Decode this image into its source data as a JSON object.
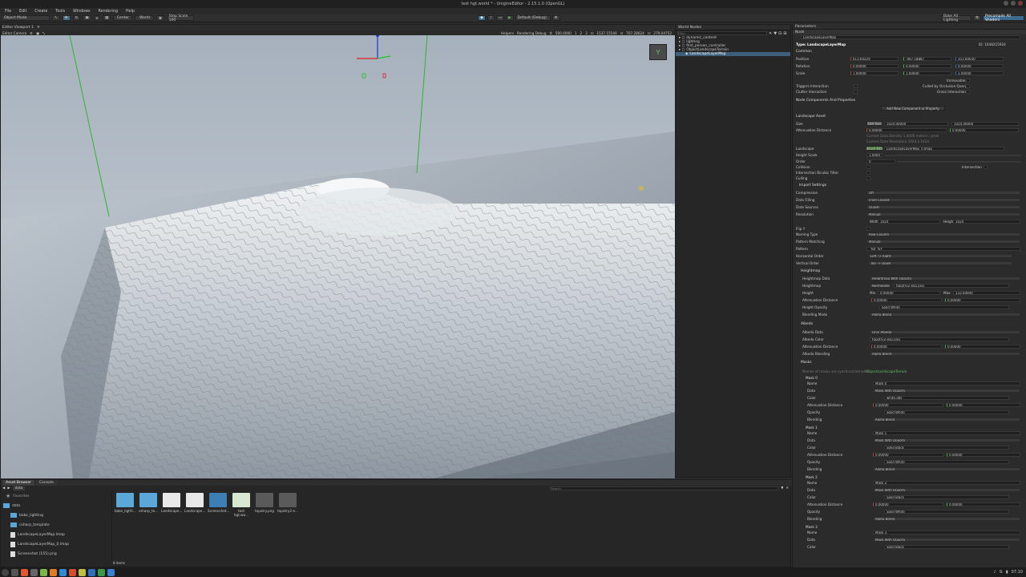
{
  "titlebar": {
    "title": "test hgt.world * - UnigineEditor - 2.15.1.0 (OpenGL)"
  },
  "menu": [
    "File",
    "Edit",
    "Create",
    "Tools",
    "Windows",
    "Rendering",
    "Help"
  ],
  "toolbar": {
    "mode": "Object Mode",
    "pivot": "Center",
    "space": "World",
    "step_label": "Step Scale 100",
    "play_label": "Default (Debug)",
    "bake_label": "Bake All Lighting",
    "precompile_label": "Precompile All Shaders"
  },
  "viewport": {
    "tab": "Editor Viewport 1",
    "camera": "Editor Camera",
    "helpers": "Helpers",
    "rendering_debug": "Rendering Debug",
    "speed": "500.0000",
    "coords": [
      "1",
      "2",
      "3"
    ],
    "x": "1537.15540",
    "y": "707.28624",
    "z": "279.04752"
  },
  "world_nodes": {
    "title": "World Nodes",
    "filter_placeholder": "Filter",
    "items": [
      {
        "label": "dynamic_content",
        "indent": 0,
        "sel": false
      },
      {
        "label": "lighting",
        "indent": 0,
        "sel": false
      },
      {
        "label": "first_person_controller",
        "indent": 0,
        "sel": false
      },
      {
        "label": "ObjectLandscapeTerrain",
        "indent": 0,
        "sel": false
      },
      {
        "label": "LandscapeLayerMap",
        "indent": 1,
        "sel": true
      }
    ]
  },
  "params": {
    "title": "Parameters",
    "tab": "Node",
    "node_name": "LandscapeLayerMap",
    "type": "Type: LandscapeLayerMap",
    "id": "ID: 1048215924",
    "common": "Common",
    "position": {
      "label": "Position",
      "x": "613.60229",
      "y": "-467.18887",
      "z": "353.00030"
    },
    "rotation": {
      "label": "Rotation",
      "x": "0.00000",
      "y": "0.00000",
      "z": "0.00000"
    },
    "scale": {
      "label": "Scale",
      "x": "1.00000",
      "y": "1.00000",
      "z": "1.00000"
    },
    "immovable": "Immovable",
    "triggers": "Triggers Interaction",
    "culled": "Culled by Occlusion Query",
    "clutter": "Clutter Interaction",
    "grass": "Grass Interaction",
    "components": "Node Components And Properties",
    "add_component": "Add New Component or Property",
    "landscape_asset": "Landscape Asset",
    "size_label": "Size",
    "size_btn": "Edit Size",
    "size_x": "1024.00000",
    "size_y": "1024.00000",
    "att_dist_label": "Attenuation Distance",
    "att_x": "0.00000",
    "att_y": "0.00000",
    "hint1": "Current Data Density 1.0000 meters / pixel",
    "hint2": "Current Data Resolution 1024 x 1024",
    "landscape_label": "Landscape",
    "brush_btn": "Brush Edit",
    "landscape_file": "LandscapeLayerMap_0.lmap",
    "height_scale_label": "Height Scale",
    "height_scale": "1.0000",
    "order_label": "Order",
    "order": "0",
    "collision_label": "Collision",
    "intersection_label": "Intersection",
    "bicubic_label": "Intersection Bicubic Filter",
    "culling_label": "Culling",
    "import_settings": "Import Settings",
    "compression_label": "Compression",
    "compression": "Off",
    "data_filling_label": "Data Filling",
    "data_filling": "From Closest",
    "data_sources_label": "Data Sources",
    "data_sources": "Quads",
    "resolution_label": "Resolution",
    "resolution": "Manual",
    "width_label": "Width",
    "width": "1024",
    "height_label": "Height",
    "height": "1024",
    "flip_label": "Flip Y",
    "naming_label": "Naming Type",
    "naming": "Row-Column",
    "pattern_matching_label": "Pattern Matching",
    "pattern_matching": "Manual",
    "pattern_label": "Pattern",
    "pattern": "_%X_%Y",
    "horiz_label": "Horizontal Order",
    "horiz": "Left -> Right",
    "vert_label": "Vertical Order",
    "vert": "Top -> Down",
    "heightmap": "Heightmap",
    "hm_data_label": "Heightmap Data",
    "hm_data": "Heightmap With Opacity",
    "hm_label": "Heightmap",
    "hm_mode": "Normalized",
    "hm_file": "topotry2-exp.png",
    "hm_height_label": "Height",
    "hm_min_label": "Min",
    "hm_min": "0.00000",
    "hm_max_label": "Max",
    "hm_max": "133.00000",
    "hm_att_label": "Attenuation Distance",
    "hm_att_x": "0.00000",
    "hm_att_y": "0.00000",
    "hm_opacity_label": "Height Opacity",
    "hm_opacity": "Solid White",
    "hm_blend_label": "Blending Mode",
    "hm_blend": "Alpha Blend",
    "albedo": "Albedo",
    "al_data_label": "Albedo Data",
    "al_data": "Only Albedo",
    "al_color_label": "Albedo Color",
    "al_file": "topotry2-exp.png",
    "al_att_label": "Attenuation Distance",
    "al_att_x": "0.00000",
    "al_att_y": "0.00000",
    "al_blend_label": "Albedo Blending",
    "al_blend": "Alpha Blend",
    "masks": "Masks",
    "masks_hint": "Names of masks are synchronized with",
    "masks_link": "ObjectLandscapeTerrain",
    "mask_items": [
      {
        "title": "Mask 0",
        "name": "Mask 0",
        "data": "Mask With Opacity",
        "color": "white.dds",
        "att_x": "0.00000",
        "att_y": "0.00000",
        "opacity": "Solid White",
        "blend": "Alpha Blend"
      },
      {
        "title": "Mask 1",
        "name": "Mask 1",
        "data": "Mask With Opacity",
        "color": "Solid Black",
        "att_x": "0.00000",
        "att_y": "0.00000",
        "opacity": "Solid White",
        "blend": "Alpha Blend"
      },
      {
        "title": "Mask 2",
        "name": "Mask 2",
        "data": "Mask With Opacity",
        "color": "Solid Black",
        "att_x": "0.00000",
        "att_y": "0.00000",
        "opacity": "Solid White",
        "blend": "Alpha Blend"
      },
      {
        "title": "Mask 3",
        "name": "Mask 3",
        "data": "Mask With Opacity",
        "color": "Solid Black"
      }
    ],
    "field_name": "Name",
    "field_data": "Data",
    "field_color": "Color",
    "field_att": "Attenuation Distance",
    "field_opacity": "Opacity",
    "field_blend": "Blending",
    "restore": "Restore Defaults",
    "reimport": "Reimport Data",
    "cancel": "Cancel"
  },
  "assets": {
    "tabs": [
      "Asset Browser",
      "Console"
    ],
    "path": "data",
    "search_placeholder": "Search",
    "favorites": "Favorites",
    "tree": [
      "data",
      "bake_lighting",
      "csharp_template",
      "LandscapeLayerMap.lmap",
      "LandscapeLayerMap_0.lmap",
      "Screenshot (155).png"
    ],
    "items": [
      {
        "label": "bake_lighti...",
        "kind": "folder"
      },
      {
        "label": "csharp_te...",
        "kind": "folder"
      },
      {
        "label": "Landscape...",
        "kind": "doc"
      },
      {
        "label": "Landscape...",
        "kind": "doc"
      },
      {
        "label": "Screenshot...",
        "kind": "shot"
      },
      {
        "label": "test hgt.wo...",
        "kind": "world"
      },
      {
        "label": "topotry.png",
        "kind": "topo"
      },
      {
        "label": "topotry2-e...",
        "kind": "topo"
      }
    ],
    "count": "8 items"
  },
  "taskbar": {
    "time": "07:10"
  },
  "colors": {
    "accent": "#3d6a8f",
    "selection": "#3d5f7c",
    "panel": "#2b2b2b"
  }
}
